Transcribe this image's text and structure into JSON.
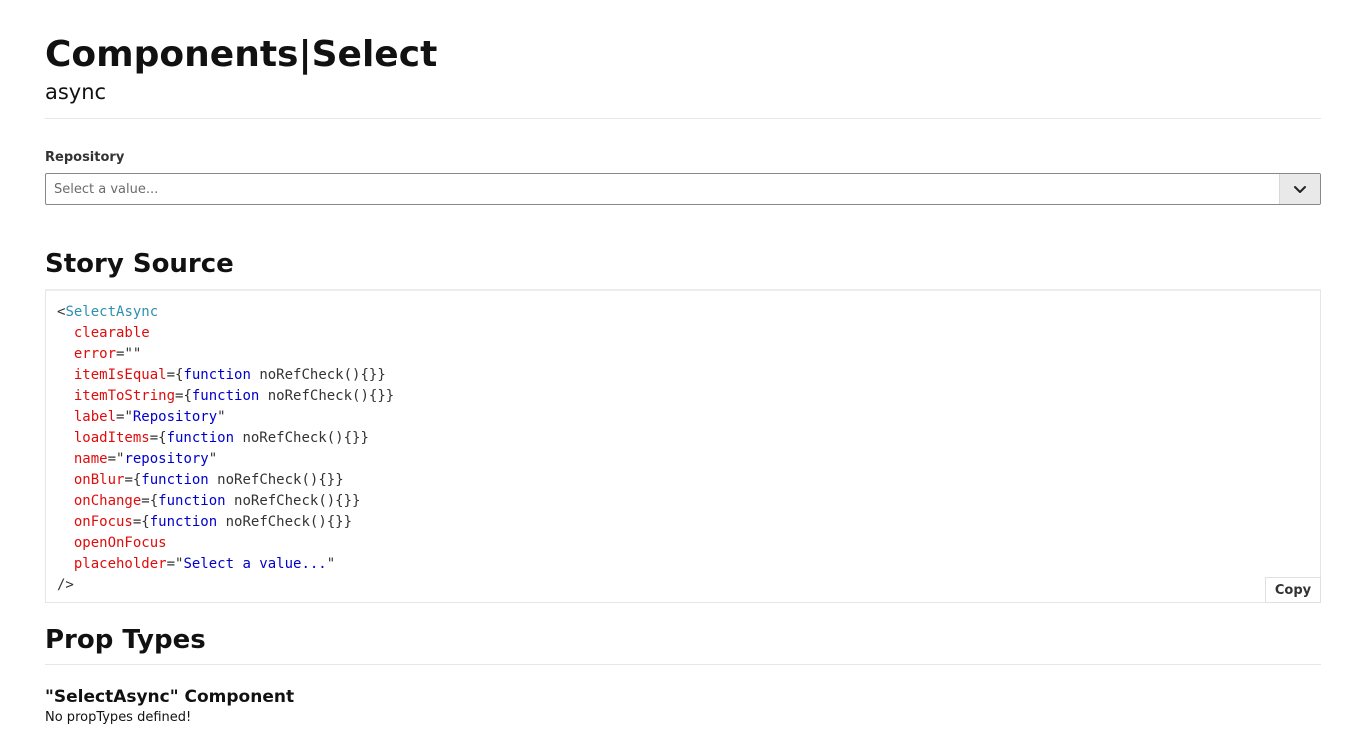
{
  "header": {
    "title": "Components|Select",
    "subtitle": "async"
  },
  "field": {
    "label": "Repository",
    "placeholder": "Select a value...",
    "toggle_icon": "chevron-down-icon"
  },
  "story_source": {
    "title": "Story Source",
    "open_bracket": "<",
    "component": "SelectAsync",
    "attributes": [
      {
        "name": "clearable"
      },
      {
        "name": "error",
        "string": ""
      },
      {
        "name": "itemIsEqual",
        "keyword": "function",
        "rest": "noRefCheck(){}"
      },
      {
        "name": "itemToString",
        "keyword": "function",
        "rest": "noRefCheck(){}"
      },
      {
        "name": "label",
        "string": "Repository"
      },
      {
        "name": "loadItems",
        "keyword": "function",
        "rest": "noRefCheck(){}"
      },
      {
        "name": "name",
        "string": "repository"
      },
      {
        "name": "onBlur",
        "keyword": "function",
        "rest": "noRefCheck(){}"
      },
      {
        "name": "onChange",
        "keyword": "function",
        "rest": "noRefCheck(){}"
      },
      {
        "name": "onFocus",
        "keyword": "function",
        "rest": "noRefCheck(){}"
      },
      {
        "name": "openOnFocus"
      },
      {
        "name": "placeholder",
        "string": "Select a value..."
      }
    ],
    "close_tag": "/>",
    "copy_label": "Copy",
    "colors": {
      "tag": "#2f8fb0",
      "attr": "#e00c0c",
      "keyword": "#0000cc",
      "string": "#0000cc"
    }
  },
  "prop_types": {
    "title": "Prop Types",
    "component_title": "\"SelectAsync\" Component",
    "message": "No propTypes defined!"
  }
}
